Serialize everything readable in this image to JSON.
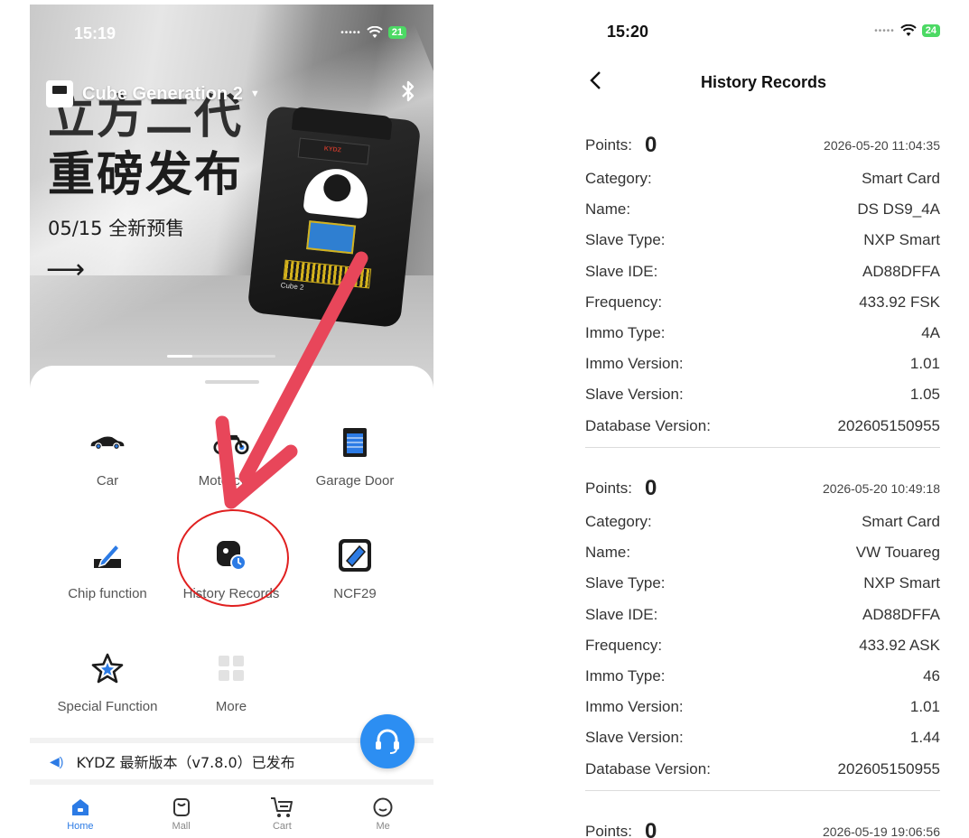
{
  "left": {
    "status": {
      "time": "15:19",
      "battery": "21"
    },
    "header": {
      "device_name": "Cube Generation 2"
    },
    "banner": {
      "line1": "立方二代",
      "line2": "重磅发布",
      "date": "05/15 全新预售",
      "device_brand": "KYDZ",
      "device_label": "Cube 2"
    },
    "functions": [
      {
        "label": "Car",
        "icon": "car-icon"
      },
      {
        "label": "Motorcycle",
        "icon": "motorcycle-icon"
      },
      {
        "label": "Garage Door",
        "icon": "garage-door-icon"
      },
      {
        "label": "Chip function",
        "icon": "chip-pen-icon"
      },
      {
        "label": "History Records",
        "icon": "history-records-icon"
      },
      {
        "label": "NCF29",
        "icon": "ncf29-icon"
      },
      {
        "label": "Special Function",
        "icon": "star-icon"
      },
      {
        "label": "More",
        "icon": "grid-icon"
      }
    ],
    "notice": "KYDZ 最新版本（v7.8.0）已发布",
    "tabs": [
      {
        "label": "Home",
        "icon": "home-icon",
        "active": true
      },
      {
        "label": "Mall",
        "icon": "bag-icon",
        "active": false
      },
      {
        "label": "Cart",
        "icon": "cart-icon",
        "active": false
      },
      {
        "label": "Me",
        "icon": "face-icon",
        "active": false
      }
    ],
    "colors": {
      "accent": "#2c7be5",
      "annotation": "#e02020",
      "arrow": "#e8465a"
    }
  },
  "right": {
    "status": {
      "time": "15:20",
      "battery": "24"
    },
    "title": "History Records",
    "labels": {
      "points": "Points:",
      "category": "Category:",
      "name": "Name:",
      "slave_type": "Slave Type:",
      "slave_ide": "Slave IDE:",
      "frequency": "Frequency:",
      "immo_type": "Immo Type:",
      "immo_version": "Immo Version:",
      "slave_version": "Slave Version:",
      "database_version": "Database Version:"
    },
    "records": [
      {
        "points": "0",
        "datetime": "2026-05-20 11:04:35",
        "category": "Smart Card",
        "name": "DS DS9_4A",
        "slave_type": "NXP Smart",
        "slave_ide": "AD88DFFA",
        "frequency": "433.92 FSK",
        "immo_type": "4A",
        "immo_version": "1.01",
        "slave_version": "1.05",
        "database_version": "202605150955"
      },
      {
        "points": "0",
        "datetime": "2026-05-20 10:49:18",
        "category": "Smart Card",
        "name": "VW Touareg",
        "slave_type": "NXP Smart",
        "slave_ide": "AD88DFFA",
        "frequency": "433.92 ASK",
        "immo_type": "46",
        "immo_version": "1.01",
        "slave_version": "1.44",
        "database_version": "202605150955"
      },
      {
        "points": "0",
        "datetime": "2026-05-19 19:06:56"
      }
    ]
  }
}
